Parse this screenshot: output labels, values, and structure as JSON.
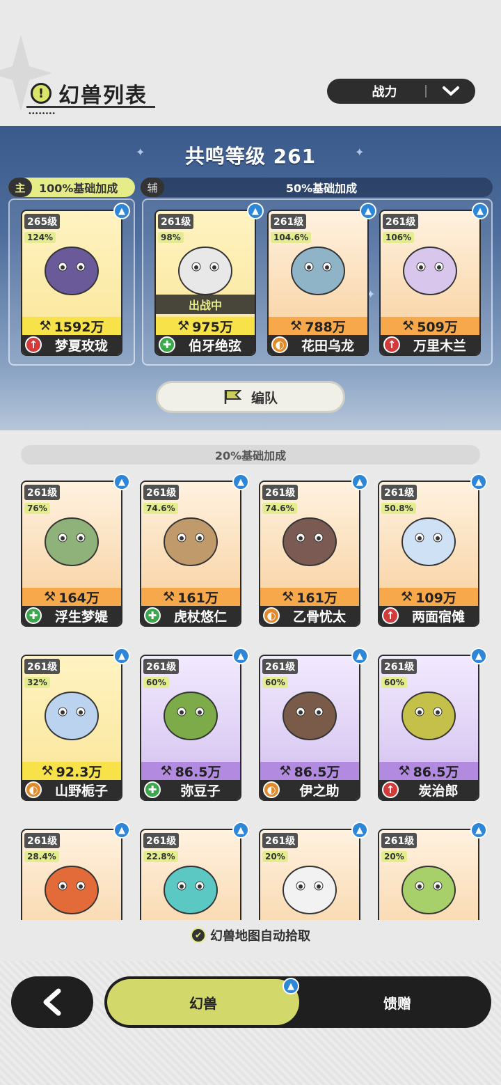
{
  "header": {
    "title": "幻兽列表",
    "title_icon": "alert-icon",
    "sort": {
      "selected": "战力"
    }
  },
  "team": {
    "resonance_label": "共鸣等级 261",
    "main_tag": {
      "chip": "主",
      "text": "100%基础加成"
    },
    "assist_tag": {
      "chip": "辅",
      "text": "50%基础加成"
    },
    "deployed_label": "出战中",
    "formation_label": "编队",
    "cards": [
      {
        "level": "265级",
        "pct": "124%",
        "power": "1592万",
        "name": "梦夏玫珑",
        "role": "atk",
        "bar": "yellow",
        "art": "#6a5a9a"
      },
      {
        "level": "261级",
        "pct": "98%",
        "power": "975万",
        "name": "伯牙绝弦",
        "role": "heal",
        "bar": "yellow",
        "art": "#e8e8e8",
        "deployed": true
      },
      {
        "level": "261级",
        "pct": "104.6%",
        "power": "788万",
        "name": "花田乌龙",
        "role": "tank",
        "bar": "orange",
        "art": "#8fb4c8"
      },
      {
        "level": "261级",
        "pct": "106%",
        "power": "509万",
        "name": "万里木兰",
        "role": "atk",
        "bar": "orange",
        "art": "#d8c6ec"
      }
    ]
  },
  "list": {
    "bonus_label": "20%基础加成",
    "cards": [
      {
        "level": "261级",
        "pct": "76%",
        "power": "164万",
        "name": "浮生梦媞",
        "role": "heal",
        "bar": "orange",
        "art": "#8fb27a"
      },
      {
        "level": "261级",
        "pct": "74.6%",
        "power": "161万",
        "name": "虎杖悠仁",
        "role": "heal",
        "bar": "orange",
        "art": "#c19a6b"
      },
      {
        "level": "261级",
        "pct": "74.6%",
        "power": "161万",
        "name": "乙骨忧太",
        "role": "tank",
        "bar": "orange",
        "art": "#7a5a52"
      },
      {
        "level": "261级",
        "pct": "50.8%",
        "power": "109万",
        "name": "两面宿傩",
        "role": "atk",
        "bar": "orange",
        "art": "#cfe1f4"
      },
      {
        "level": "261级",
        "pct": "32%",
        "power": "92.3万",
        "name": "山野栀子",
        "role": "tank",
        "bar": "yellow",
        "art": "#bcd3ef"
      },
      {
        "level": "261级",
        "pct": "60%",
        "power": "86.5万",
        "name": "弥豆子",
        "role": "heal",
        "bar": "purple",
        "art": "#7dab4a"
      },
      {
        "level": "261级",
        "pct": "60%",
        "power": "86.5万",
        "name": "伊之助",
        "role": "tank",
        "bar": "purple",
        "art": "#7a5a48"
      },
      {
        "level": "261级",
        "pct": "60%",
        "power": "86.5万",
        "name": "炭治郎",
        "role": "atk",
        "bar": "purple",
        "art": "#c5c04a"
      },
      {
        "level": "261级",
        "pct": "28.4%",
        "art": "#e36b3a"
      },
      {
        "level": "261级",
        "pct": "22.8%",
        "art": "#5cc8c4"
      },
      {
        "level": "261级",
        "pct": "20%",
        "art": "#f2f2f2"
      },
      {
        "level": "261级",
        "pct": "20%",
        "art": "#a7cf6a"
      }
    ]
  },
  "auto_pick_label": "幻兽地图自动拾取",
  "tabs": {
    "active": "幻兽",
    "gift": "馈赠"
  },
  "colors": {
    "accent": "#d3d86a",
    "panel": "#3a5a8c",
    "dark": "#1f1f1f"
  }
}
